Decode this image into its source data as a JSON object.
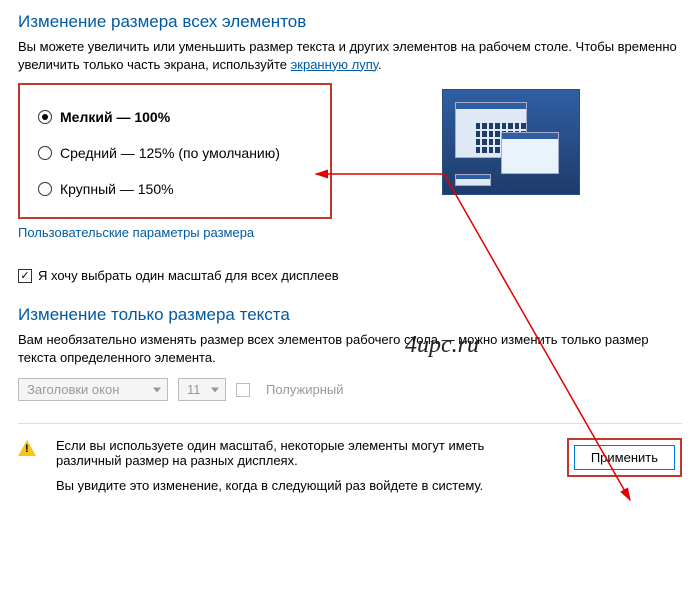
{
  "section1": {
    "title": "Изменение размера всех элементов",
    "desc_before_link": "Вы можете увеличить или уменьшить размер текста и других элементов на рабочем столе. Чтобы временно увеличить только часть экрана, используйте ",
    "link": "экранную лупу",
    "desc_after_link": "."
  },
  "sizes": {
    "small": "Мелкий — 100%",
    "medium": "Средний — 125% (по умолчанию)",
    "large": "Крупный — 150%"
  },
  "custom_link": "Пользовательские параметры размера",
  "single_scale_checkbox": "Я хочу выбрать один масштаб для всех дисплеев",
  "section2": {
    "title": "Изменение только размера текста",
    "desc": "Вам необязательно изменять размер всех элементов рабочего стола — можно изменить только размер текста определенного элемента."
  },
  "text_options": {
    "element_select": "Заголовки окон",
    "size_select": "11",
    "bold_label": "Полужирный"
  },
  "warning": {
    "line1": "Если вы используете один масштаб, некоторые элементы могут иметь различный размер на разных дисплеях.",
    "line2": "Вы увидите это изменение, когда в следующий раз войдете в систему."
  },
  "apply_button": "Применить",
  "watermark": "4upc.ru"
}
